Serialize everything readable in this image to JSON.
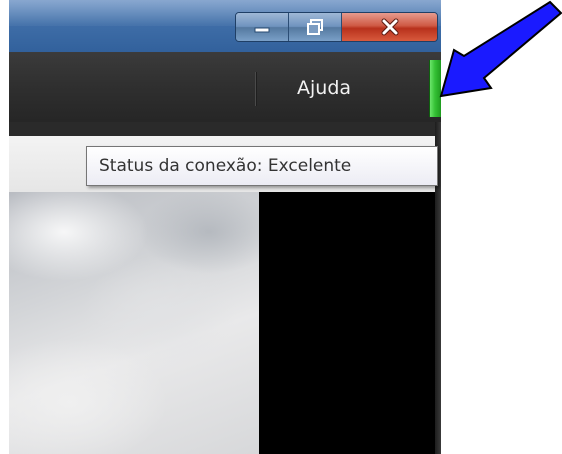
{
  "window": {
    "caption_buttons": {
      "minimize": "minimize-icon",
      "maximize": "maximize-icon",
      "close": "close-icon"
    }
  },
  "menu": {
    "help_label": "Ajuda"
  },
  "connection_status": {
    "tooltip": "Status da conexão: Excelente",
    "indicator_color": "#2fbf2f"
  },
  "annotation": {
    "arrow_color": "#1a1aff",
    "icon": "arrow-icon"
  }
}
